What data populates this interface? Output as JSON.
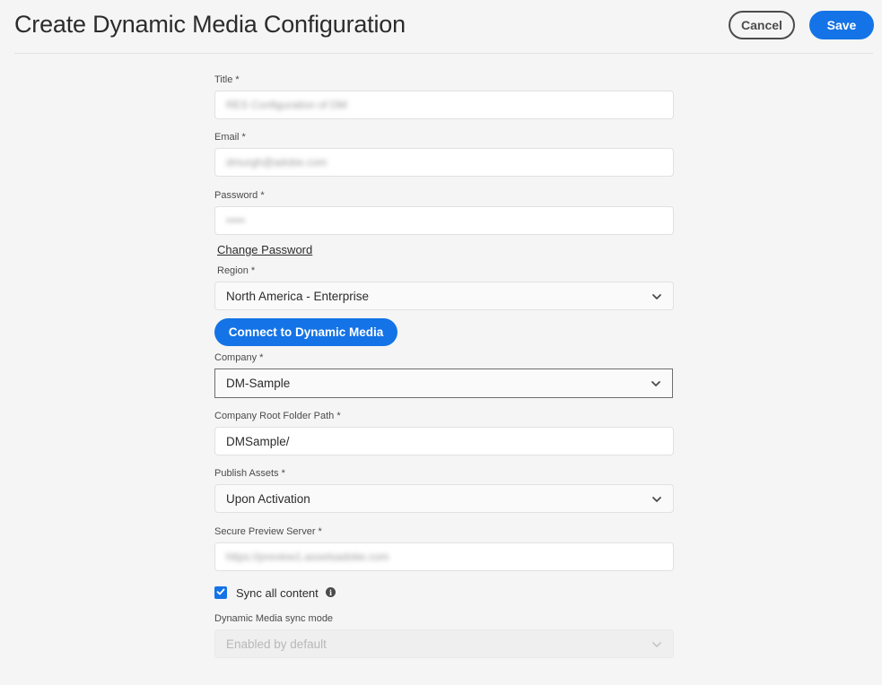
{
  "header": {
    "title": "Create Dynamic Media Configuration",
    "cancel_label": "Cancel",
    "save_label": "Save"
  },
  "form": {
    "title": {
      "label": "Title *",
      "value": "RES Configuration of DM"
    },
    "email": {
      "label": "Email *",
      "value": "dmurgh@adobe.com"
    },
    "password": {
      "label": "Password *",
      "value": "•••••"
    },
    "change_password_label": "Change Password",
    "region": {
      "label": "Region *",
      "value": "North America - Enterprise"
    },
    "connect_label": "Connect to Dynamic Media",
    "company": {
      "label": "Company *",
      "value": "DM-Sample"
    },
    "root_folder": {
      "label": "Company Root Folder Path *",
      "value": "DMSample/"
    },
    "publish_assets": {
      "label": "Publish Assets *",
      "value": "Upon Activation"
    },
    "preview_server": {
      "label": "Secure Preview Server *",
      "value": "https://preview1.assetsadobe.com"
    },
    "sync_all": {
      "label": "Sync all content",
      "checked": true
    },
    "sync_mode": {
      "label": "Dynamic Media sync mode",
      "value": "Enabled by default"
    }
  },
  "icons": {
    "chevron": "chevron-down-icon",
    "info": "info-icon",
    "check": "checkmark-icon"
  },
  "colors": {
    "accent": "#1473e6",
    "background": "#f5f5f5"
  }
}
